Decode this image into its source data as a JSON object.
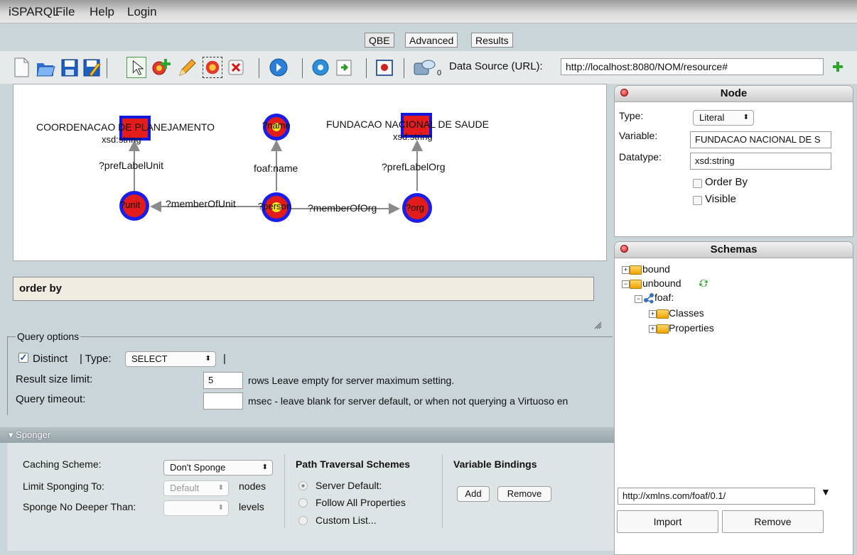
{
  "menu": [
    "iSPARQL",
    "File",
    "Help",
    "Login"
  ],
  "tabs": [
    "QBE",
    "Advanced",
    "Results"
  ],
  "toolbar": {
    "datasource_count": "0",
    "datasource_label": "Data Source (URL):",
    "datasource_value": "http://localhost:8080/NOM/resource#",
    "icons": [
      "new-file-icon",
      "open-folder-icon",
      "save-icon",
      "save-as-icon",
      "select-arrow-icon",
      "add-node-icon",
      "pencil-icon",
      "remove-pattern-icon",
      "delete-icon",
      "run-query-icon",
      "settings-gear-icon",
      "import-icon",
      "clear-icon",
      "datasource-icon",
      "add-icon"
    ]
  },
  "graph": {
    "nodes": {
      "unit": "?unit",
      "person": "?person",
      "org": "?org",
      "name": "?name"
    },
    "literals": {
      "unit_text": "COORDENACAO DE PLANEJAMENTO",
      "unit_type": "xsd:string",
      "org_text": "FUNDACAO NACIONAL DE SAUDE",
      "org_type": "xsd:string"
    },
    "edges": {
      "pref_label_unit": "?prefLabelUnit",
      "foaf_name": "foaf:name",
      "pref_label_org": "?prefLabelOrg",
      "member_of_unit": "?memberOfUnit",
      "member_of_org": "?memberOfOrg"
    }
  },
  "order_by": "order by",
  "query_options": {
    "legend": "Query options",
    "distinct_label": "Distinct",
    "distinct_checked": true,
    "type_label": "| Type:",
    "type_value": "SELECT",
    "pipe": "|",
    "limit_label": "Result size limit:",
    "limit_value": "5",
    "limit_hint": "rows Leave empty for server maximum setting.",
    "timeout_label": "Query timeout:",
    "timeout_value": "",
    "timeout_hint": "msec - leave blank for server default, or when not querying a Virtuoso en"
  },
  "sponger": {
    "title": "Sponger",
    "caching_label": "Caching Scheme:",
    "caching_value": "Don't Sponge",
    "limit_label": "Limit Sponging To:",
    "limit_value": "Default",
    "limit_unit": "nodes",
    "depth_label": "Sponge No Deeper Than:",
    "depth_value": "",
    "depth_unit": "levels",
    "path_title": "Path Traversal Schemes",
    "path_options": [
      "Server Default:",
      "Follow All Properties",
      "Custom List..."
    ],
    "bindings_title": "Variable Bindings",
    "add": "Add",
    "remove": "Remove"
  },
  "node_panel": {
    "title": "Node",
    "type_label": "Type:",
    "type_value": "Literal",
    "variable_label": "Variable:",
    "variable_value": "FUNDACAO NACIONAL DE S",
    "datatype_label": "Datatype:",
    "datatype_value": "xsd:string",
    "order_by": "Order By",
    "visible": "Visible"
  },
  "schemas_panel": {
    "title": "Schemas",
    "tree": {
      "bound": "bound",
      "unbound": "unbound",
      "foaf": "foaf:",
      "classes": "Classes",
      "properties": "Properties"
    },
    "url_value": "http://xmlns.com/foaf/0.1/",
    "import": "Import",
    "remove": "Remove"
  }
}
